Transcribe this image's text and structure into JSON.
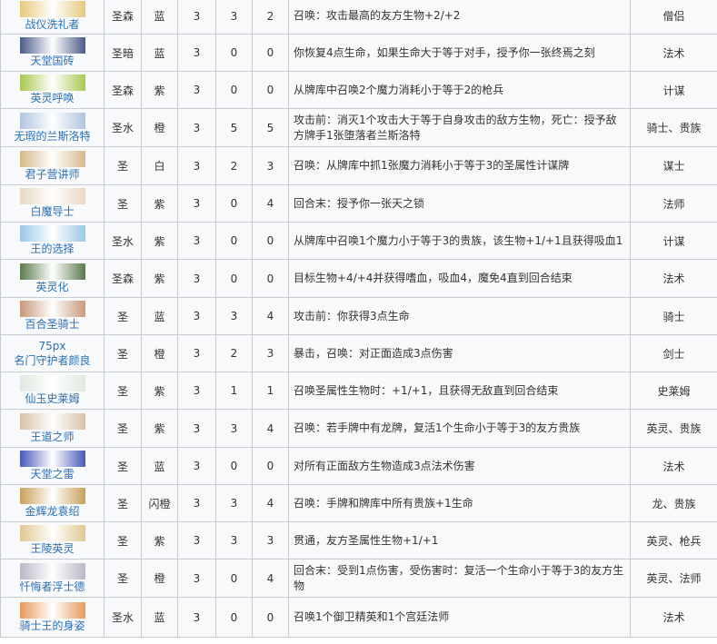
{
  "rows": [
    {
      "name": "战仪洗礼者",
      "faction": "圣森",
      "rarity": "蓝",
      "cost": "3",
      "attack": "3",
      "health": "2",
      "effect": "召唤：攻击最高的友方生物+2/+2",
      "tag": "僧侣",
      "art": "#e8c87a"
    },
    {
      "name": "天堂国砖",
      "faction": "圣暗",
      "rarity": "蓝",
      "cost": "3",
      "attack": "0",
      "health": "0",
      "effect": "你恢复4点生命，如果生命大于等于对手，授予你一张终焉之刻",
      "tag": "法术",
      "art": "#4a5a8a"
    },
    {
      "name": "英灵呼唤",
      "faction": "圣森",
      "rarity": "紫",
      "cost": "3",
      "attack": "0",
      "health": "0",
      "effect": "从牌库中召唤2个魔力消耗小于等于2的枪兵",
      "tag": "计谋",
      "art": "#a8c850"
    },
    {
      "name": "无瑕的兰斯洛特",
      "faction": "圣水",
      "rarity": "橙",
      "cost": "3",
      "attack": "5",
      "health": "5",
      "effect": "攻击前：消灭1个攻击大于等于自身攻击的敌方生物，死亡：授予敌方牌手1张堕落者兰斯洛特",
      "tag": "骑士、贵族",
      "art": "#b0c4de"
    },
    {
      "name": "君子营讲师",
      "faction": "圣",
      "rarity": "白",
      "cost": "3",
      "attack": "2",
      "health": "3",
      "effect": "召唤：从牌库中抓1张魔力消耗小于等于3的圣属性计谋牌",
      "tag": "谋士",
      "art": "#d8b888"
    },
    {
      "name": "白魔导士",
      "faction": "圣",
      "rarity": "紫",
      "cost": "3",
      "attack": "0",
      "health": "4",
      "effect": "回合末：授予你一张天之锁",
      "tag": "法师",
      "art": "#e8d8c0"
    },
    {
      "name": "王的选择",
      "faction": "圣水",
      "rarity": "紫",
      "cost": "3",
      "attack": "0",
      "health": "0",
      "effect": "从牌库中召唤1个魔力小于等于3的贵族，该生物+1/+1且获得吸血1",
      "tag": "计谋",
      "art": "#98c8e8"
    },
    {
      "name": "英灵化",
      "faction": "圣森",
      "rarity": "紫",
      "cost": "3",
      "attack": "0",
      "health": "0",
      "effect": "目标生物+4/+4并获得嗜血，吸血4，魔免4直到回合结束",
      "tag": "法术",
      "art": "#5a7a4a"
    },
    {
      "name": "百合圣骑士",
      "faction": "圣",
      "rarity": "蓝",
      "cost": "3",
      "attack": "3",
      "health": "4",
      "effect": "攻击前：你获得3点生命",
      "tag": "骑士",
      "art": "#c89878"
    },
    {
      "name": "名门守护者颜良",
      "faction": "圣",
      "rarity": "橙",
      "cost": "3",
      "attack": "2",
      "health": "3",
      "effect": "暴击，召唤：对正面造成3点伤害",
      "tag": "剑士",
      "art": "",
      "placeholder": "75px"
    },
    {
      "name": "仙玉史莱姆",
      "faction": "圣",
      "rarity": "紫",
      "cost": "3",
      "attack": "1",
      "health": "1",
      "effect": "召唤圣属性生物时：+1/+1，且获得无敌直到回合结束",
      "tag": "史莱姆",
      "art": "#e0e8e0"
    },
    {
      "name": "王道之师",
      "faction": "圣",
      "rarity": "紫",
      "cost": "3",
      "attack": "3",
      "health": "4",
      "effect": "召唤：若手牌中有龙牌，复活1个生命小于等于3的友方贵族",
      "tag": "英灵、贵族",
      "art": "#d8c0a8"
    },
    {
      "name": "天堂之雷",
      "faction": "圣",
      "rarity": "蓝",
      "cost": "3",
      "attack": "0",
      "health": "0",
      "effect": "对所有正面敌方生物造成3点法术伤害",
      "tag": "法术",
      "art": "#4858b8"
    },
    {
      "name": "金辉龙袁绍",
      "faction": "圣",
      "rarity": "闪橙",
      "cost": "3",
      "attack": "3",
      "health": "4",
      "effect": "召唤：手牌和牌库中所有贵族+1生命",
      "tag": "龙、贵族",
      "art": "#c8a058"
    },
    {
      "name": "王陵英灵",
      "faction": "圣",
      "rarity": "紫",
      "cost": "3",
      "attack": "3",
      "health": "3",
      "effect": "贯通，友方圣属性生物+1/+1",
      "tag": "英灵、枪兵",
      "art": "#e0c890"
    },
    {
      "name": "忏悔者浮士德",
      "faction": "圣",
      "rarity": "橙",
      "cost": "3",
      "attack": "0",
      "health": "4",
      "effect": "回合末：受到1点伤害，受伤害时：复活一个生命小于等于3的友方生物",
      "tag": "英灵、法师",
      "art": "#b8b8c8"
    },
    {
      "name": "骑士王的身姿",
      "faction": "圣水",
      "rarity": "蓝",
      "cost": "3",
      "attack": "0",
      "health": "0",
      "effect": "召唤1个御卫精英和1个宫廷法师",
      "tag": "法术",
      "art": "#e89858"
    }
  ]
}
